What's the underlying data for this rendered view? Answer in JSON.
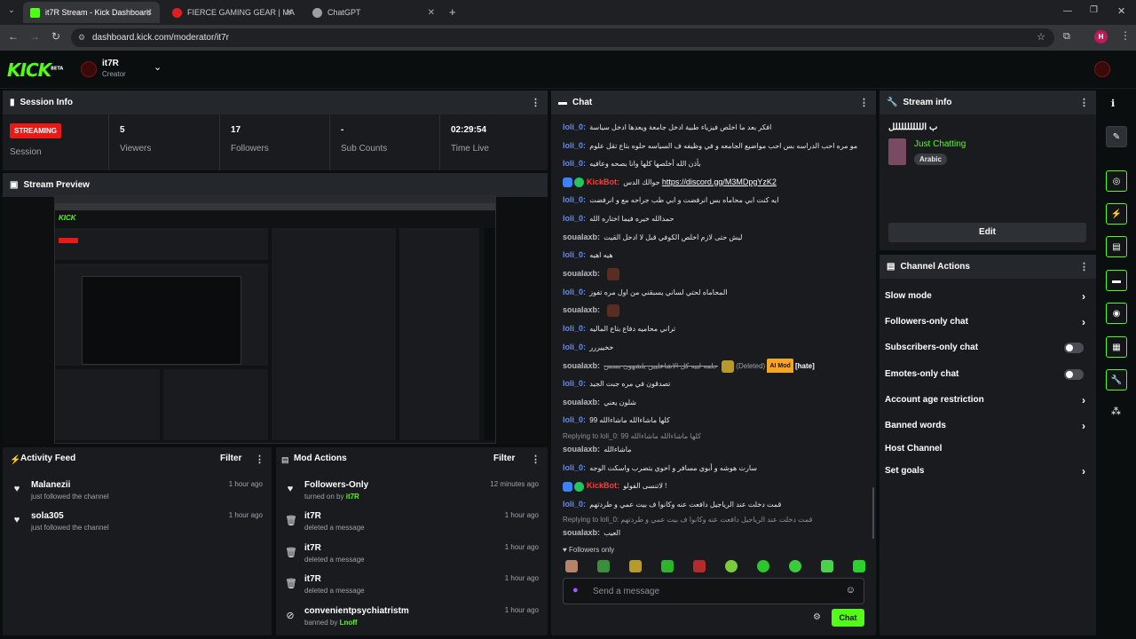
{
  "browser": {
    "tabs": [
      {
        "title": "it7R Stream - Kick Dashboard",
        "close": "✕",
        "favcolor": "#53fc18"
      },
      {
        "title": "FIERCE GAMING GEAR | MA",
        "close": "✕",
        "favcolor": "#e01e1e"
      },
      {
        "title": "ChatGPT",
        "close": "✕",
        "favcolor": "#9aa0a6"
      }
    ],
    "new_tab": "+",
    "url": "dashboard.kick.com/moderator/it7r",
    "profile_initial": "H"
  },
  "header": {
    "logo": "KICK",
    "logo_beta": "BETA",
    "channel_name": "it7R",
    "channel_role": "Creator"
  },
  "session": {
    "title": "Session Info",
    "status_badge": "STREAMING",
    "status_label": "Session",
    "stats": [
      {
        "value": "5",
        "label": "Viewers"
      },
      {
        "value": "17",
        "label": "Followers"
      },
      {
        "value": "-",
        "label": "Sub Counts"
      },
      {
        "value": "02:29:54",
        "label": "Time Live"
      }
    ]
  },
  "preview": {
    "title": "Stream Preview"
  },
  "activity": {
    "title": "Activity Feed",
    "filter": "Filter",
    "items": [
      {
        "name": "Malanezii",
        "sub": "just followed the channel",
        "time": "1 hour ago"
      },
      {
        "name": "sola305",
        "sub": "just followed the channel",
        "time": "1 hour ago"
      }
    ]
  },
  "mod_actions": {
    "title": "Mod Actions",
    "filter": "Filter",
    "items": [
      {
        "name": "Followers-Only",
        "sub": "turned on by",
        "by": "it7R",
        "time": "12 minutes ago"
      },
      {
        "name": "it7R",
        "sub": "deleted a message",
        "by": "",
        "time": "1 hour ago"
      },
      {
        "name": "it7R",
        "sub": "deleted a message",
        "by": "",
        "time": "1 hour ago"
      },
      {
        "name": "it7R",
        "sub": "deleted a message",
        "by": "",
        "time": "1 hour ago"
      },
      {
        "name": "convenientpsychiatristm",
        "sub": "banned by",
        "by": "Lnoff",
        "time": "1 hour ago"
      }
    ]
  },
  "chat": {
    "title": "Chat",
    "messages": [
      {
        "user": "loli_0",
        "text": "افكر بعد ما اخلص فيزياء طبية ادخل جامعة ويعدها ادخل سياسة"
      },
      {
        "user": "loli_0",
        "text": "مو مره احب الدراسه بس احب مواضيع الجامعه و في وظيفه ف السياسه حلوه بتاع تقل علوم"
      },
      {
        "user": "loli_0",
        "text": "بأذن الله أخلصها كلها وانا بصحه وعافيه"
      },
      {
        "user": "KickBot",
        "text": "جوالك الدس",
        "link": "https://discord.gg/M3MDpgYzK2"
      },
      {
        "user": "loli_0",
        "text": "ايه كنت ابي محاماه بس انرفضت و ابي طب جراحه مع و انرفضت"
      },
      {
        "user": "loli_0",
        "text": "حمدالله خيره فيما اختاره الله"
      },
      {
        "user": "soualaxb",
        "text": "ليش حتى لازم اخلص الكوفي قبل لا ادخل القيت"
      },
      {
        "user": "loli_0",
        "text": "هيه اهيه"
      },
      {
        "user": "soualaxb",
        "text": ""
      },
      {
        "user": "loli_0",
        "text": "المحاماه لحتي لساني يسبقني من اول مره تفوز"
      },
      {
        "user": "soualaxb",
        "text": ""
      },
      {
        "user": "loli_0",
        "text": "تراني محاميه دفاع بتاع الماليه"
      },
      {
        "user": "loli_0",
        "text": "خخييررر"
      },
      {
        "user": "soualaxb",
        "text": "حلمه لبيه كل الاشاعليين يلشهون بسس",
        "deleted": "(Deleted)",
        "automod": "AI Mod",
        "tag": "[hate]"
      },
      {
        "user": "loli_0",
        "text": "تصدقون في مره جبت الجيد"
      },
      {
        "user": "soualaxb",
        "text": "شلون يعني"
      },
      {
        "user": "loli_0",
        "text": "كلها ماشاءالله ماشاءالله 99"
      },
      {
        "user": "soualaxb",
        "text": "ماشاءالله",
        "reply": "Replying to loli_0: 99 كلها ماشاءالله ماشاءالله"
      },
      {
        "user": "loli_0",
        "text": "سارت هوشه و أبوي مسافر و اخوي يتضرب واسكت الوجه"
      },
      {
        "user": "KickBot",
        "text": "لاتنسى الفولو !"
      },
      {
        "user": "loli_0",
        "text": "قمت دخلت عند الرياجيل دافعت عنه وكانوا ف بيت عمي و طردتهم"
      },
      {
        "user": "soualaxb",
        "text": "العيب",
        "reply": "Replying to loli_0: قمت دخلت عند الرياجيل دافعت عنه وكانوا ف بيت عمي و طردتهم"
      }
    ],
    "followers_only": "Followers only",
    "placeholder": "Send a message",
    "send": "Chat"
  },
  "stream_info": {
    "title": "Stream info",
    "stream_title": "ب اللللللللللل",
    "category": "Just Chatting",
    "tag": "Arabic",
    "edit": "Edit"
  },
  "channel_actions": {
    "title": "Channel Actions",
    "items": [
      {
        "label": "Slow mode",
        "kind": "chevron"
      },
      {
        "label": "Followers-only chat",
        "kind": "chevron"
      },
      {
        "label": "Subscribers-only chat",
        "kind": "toggle"
      },
      {
        "label": "Emotes-only chat",
        "kind": "toggle"
      },
      {
        "label": "Account age restriction",
        "kind": "chevron"
      },
      {
        "label": "Banned words",
        "kind": "chevron"
      },
      {
        "label": "Host Channel",
        "kind": "none"
      },
      {
        "label": "Set goals",
        "kind": "chevron"
      }
    ]
  },
  "colors": {
    "accent": "#53fc18",
    "live": "#e91916",
    "username_blue": "#5d8cff",
    "bot": "#ff3b3b"
  }
}
